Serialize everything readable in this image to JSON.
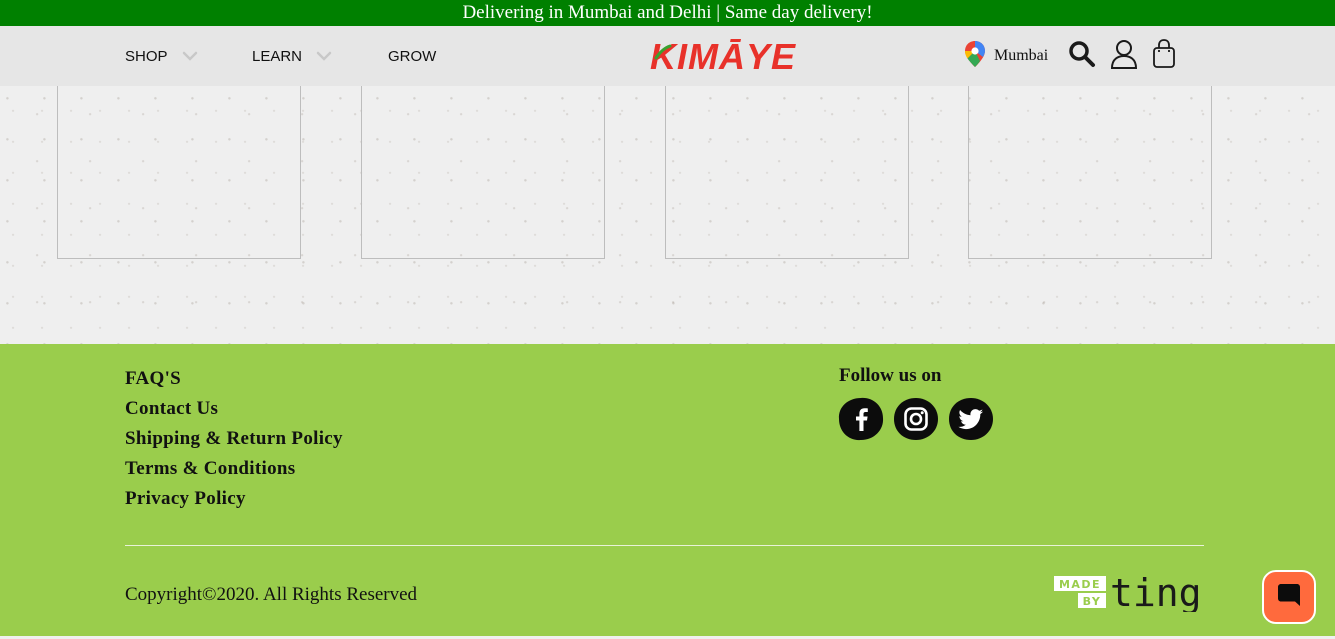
{
  "announcement": "Delivering in Mumbai and Delhi | Same day delivery!",
  "nav": {
    "items": [
      {
        "label": "SHOP",
        "has_dropdown": true
      },
      {
        "label": "LEARN",
        "has_dropdown": true
      },
      {
        "label": "GROW",
        "has_dropdown": false
      }
    ]
  },
  "brand": {
    "logo_text": "KIMĀYE",
    "logo_color": "#e8312a"
  },
  "header_right": {
    "location_icon": "map-pin-icon",
    "city": "Mumbai",
    "icons": [
      "search-icon",
      "user-icon",
      "shopping-bag-icon"
    ]
  },
  "footer": {
    "links": [
      "FAQ'S",
      "Contact Us",
      "Shipping & Return Policy",
      "Terms & Conditions",
      "Privacy Policy"
    ],
    "follow_label": "Follow us on",
    "social": [
      "facebook-icon",
      "instagram-icon",
      "twitter-icon"
    ],
    "copyright": "Copyright©2020. All Rights Reserved",
    "made_by": {
      "line1": "MADE",
      "line2": "BY",
      "brand": "ting"
    }
  },
  "colors": {
    "announcement_bg": "#008000",
    "header_bg": "#e6e6e6",
    "footer_bg": "#9acd4c",
    "chat_bg": "#ff6a3d"
  },
  "chat": {
    "icon": "chat-icon"
  }
}
